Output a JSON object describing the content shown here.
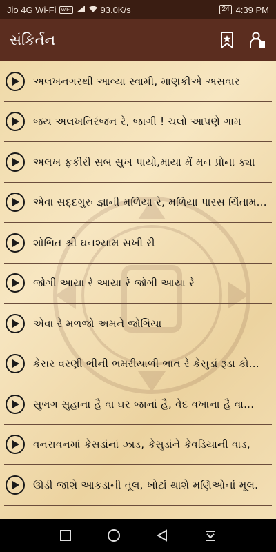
{
  "status_bar": {
    "carrier": "Jio 4G Wi-Fi",
    "wifi_badge": "WiFi",
    "speed": "93.0K/s",
    "battery": "24",
    "time": "4:39 PM"
  },
  "app_bar": {
    "title": "સંકિર્તન"
  },
  "colors": {
    "status_bar": "#3a1d12",
    "app_bar": "#5b2d1f",
    "parchment": "#f3dfb5",
    "divider": "#6b4d3c"
  },
  "items": [
    {
      "label": "અલખનગરથી આવ્યા સ્વામી, માણકીએ અસવાર"
    },
    {
      "label": "જય અલખનિરંજન રે, જાગી ! ચલો આપણે ગામ"
    },
    {
      "label": "અલખ ફકીરી સબ સુખ પાયો,માયા મેં મન પ્રોના ક્યા"
    },
    {
      "label": "એવા સદ્દગુરુ જ્ઞાની મળિયા રે, મળિયા પારસ ચિંતામ..."
    },
    {
      "label": "શોભિત શ્રી ઘનશ્યામ સખી રી"
    },
    {
      "label": "જોગી આયા રે આયા રે જોગી આયા રે"
    },
    {
      "label": "એવા રે મળજો અમને જોગિયા"
    },
    {
      "label": "કેસર વરણી ભીની ભમરીયાળી ભાત રે કેસુડાં રૂડા કો..."
    },
    {
      "label": "સુભગ સુહાના હૈ વા ઘર જાનાં હૈ,  વેદ વખાના હૈ વા..."
    },
    {
      "label": "વનરાવનમાં કેસડાંનાં ઝાડ, કેસુડાંને કેવડિયાની વાડ,"
    },
    {
      "label": "ઊડી જાશે આકડાની તૂલ, ખોટાં થાશે મણિઓનાં મૂલ."
    }
  ]
}
